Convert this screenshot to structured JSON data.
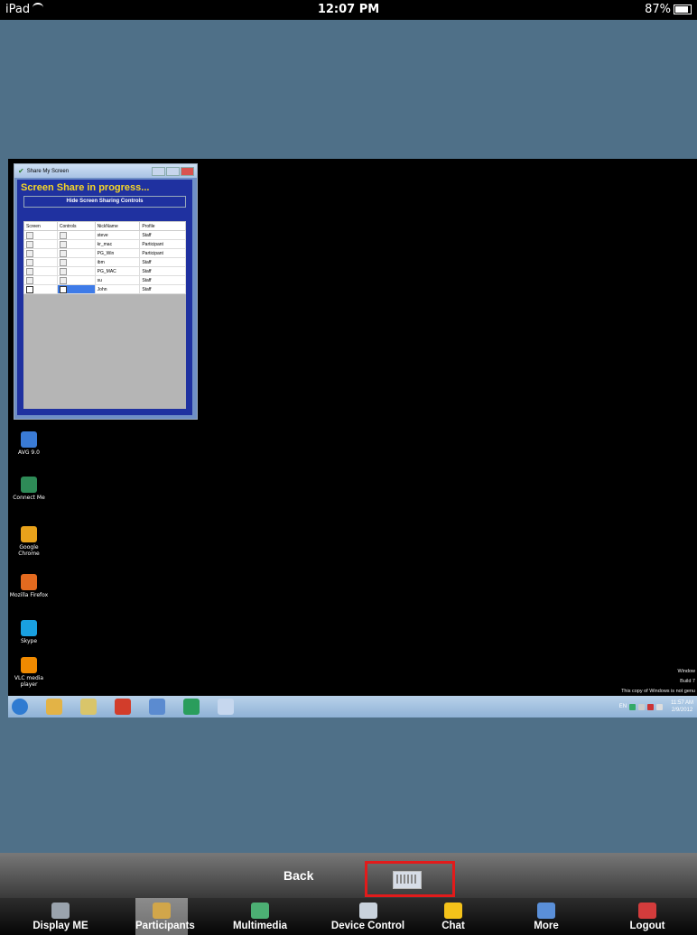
{
  "status_bar": {
    "device": "iPad",
    "time": "12:07 PM",
    "battery": "87%"
  },
  "share_window": {
    "title": "Share My Screen",
    "heading": "Screen Share in progress...",
    "hide_button": "Hide Screen Sharing Controls",
    "columns": [
      "Screen",
      "Controls",
      "NickName",
      "Profile"
    ],
    "rows": [
      {
        "screen": false,
        "controls": false,
        "nick": "steve",
        "profile": "Staff"
      },
      {
        "screen": false,
        "controls": false,
        "nick": "kr_mac",
        "profile": "Participant"
      },
      {
        "screen": false,
        "controls": false,
        "nick": "PG_Win",
        "profile": "Participant"
      },
      {
        "screen": false,
        "controls": false,
        "nick": "ibm",
        "profile": "Staff"
      },
      {
        "screen": false,
        "controls": false,
        "nick": "PG_MAC",
        "profile": "Staff"
      },
      {
        "screen": false,
        "controls": false,
        "nick": "su",
        "profile": "Staff"
      },
      {
        "screen": true,
        "controls": true,
        "nick": "John",
        "profile": "Staff"
      }
    ]
  },
  "desktop_icons": [
    {
      "label": "AVG 9.0",
      "icon": "avg-icon",
      "color": "#3a7bd5"
    },
    {
      "label": "Connect Me",
      "icon": "connect-me-icon",
      "color": "#2e8b57"
    },
    {
      "label": "Google Chrome",
      "icon": "chrome-icon",
      "color": "#e8a21b"
    },
    {
      "label": "Mozilla Firefox",
      "icon": "firefox-icon",
      "color": "#e36a1f"
    },
    {
      "label": "Skype",
      "icon": "skype-icon",
      "color": "#19a0e0"
    },
    {
      "label": "VLC media player",
      "icon": "vlc-icon",
      "color": "#f08a00"
    }
  ],
  "windows_notice": {
    "line1": "Window",
    "line2": "Build 7",
    "line3": "This copy of Windows is not genu"
  },
  "taskbar": {
    "tray_lang": "EN",
    "clock_time": "11:57 AM",
    "clock_date": "2/9/2012",
    "icons": [
      {
        "name": "start-orb-icon",
        "color": "#2f7bd1"
      },
      {
        "name": "explorer-icon",
        "color": "#e3b346"
      },
      {
        "name": "notes-icon",
        "color": "#d9c56a"
      },
      {
        "name": "chrome-taskbar-icon",
        "color": "#d23d2b"
      },
      {
        "name": "window-taskbar-icon",
        "color": "#5b8bd0"
      },
      {
        "name": "app-taskbar-icon",
        "color": "#2a9d5c"
      },
      {
        "name": "paint-taskbar-icon",
        "color": "#c6d7ee"
      }
    ]
  },
  "bottom": {
    "back_label": "Back",
    "tabs": [
      {
        "label": "Display ME",
        "icon": "camera-icon",
        "color": "#9aa3ad",
        "selected": false
      },
      {
        "label": "Participants",
        "icon": "participants-icon",
        "color": "#d1a64a",
        "selected": true
      },
      {
        "label": "Multimedia",
        "icon": "multimedia-icon",
        "color": "#4caf73",
        "selected": false
      },
      {
        "label": "Device Control",
        "icon": "device-control-icon",
        "color": "#c9d2dc",
        "selected": false
      },
      {
        "label": "Chat",
        "icon": "chat-icon",
        "color": "#f4c21a",
        "selected": false
      },
      {
        "label": "More",
        "icon": "more-icon",
        "color": "#5a8fd8",
        "selected": false
      },
      {
        "label": "Logout",
        "icon": "logout-icon",
        "color": "#d33c3c",
        "selected": false
      }
    ]
  }
}
